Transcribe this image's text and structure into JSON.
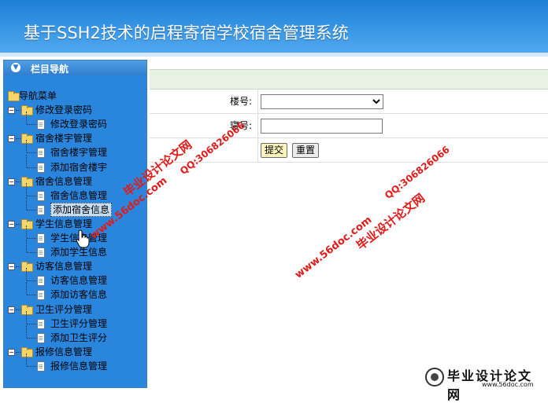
{
  "header": {
    "title": "基于SSH2技术的启程寄宿学校宿舍管理系统"
  },
  "sidebar": {
    "heading": "栏目导航",
    "root": "导航菜单",
    "groups": [
      {
        "label": "修改登录密码",
        "items": [
          "修改登录密码"
        ]
      },
      {
        "label": "宿舍楼宇管理",
        "items": [
          "宿舍楼宇管理",
          "添加宿舍楼宇"
        ]
      },
      {
        "label": "宿舍信息管理",
        "items": [
          "宿舍信息管理",
          "添加宿舍信息"
        ]
      },
      {
        "label": "学生信息管理",
        "items": [
          "学生信息管理",
          "添加学生信息"
        ]
      },
      {
        "label": "访客信息管理",
        "items": [
          "访客信息管理",
          "添加访客信息"
        ]
      },
      {
        "label": "卫生评分管理",
        "items": [
          "卫生评分管理",
          "添加卫生评分"
        ]
      },
      {
        "label": "报修信息管理",
        "items": [
          "报修信息管理"
        ]
      }
    ],
    "selected": "添加宿舍信息"
  },
  "form": {
    "building_label": "楼号:",
    "building_value": "",
    "room_label": "寝号:",
    "room_value": "",
    "submit_label": "提交",
    "reset_label": "重置"
  },
  "watermarks": {
    "site": "www.56doc.com",
    "qq": "QQ:306826066",
    "brand": "毕业设计论文网"
  },
  "footer_logo": {
    "text": "毕业设计论文网",
    "url": "www.56doc.com"
  },
  "colors": {
    "header": "#2a8ae0",
    "sidebar": "#2a86dd",
    "watermark": "#e11a1a"
  }
}
